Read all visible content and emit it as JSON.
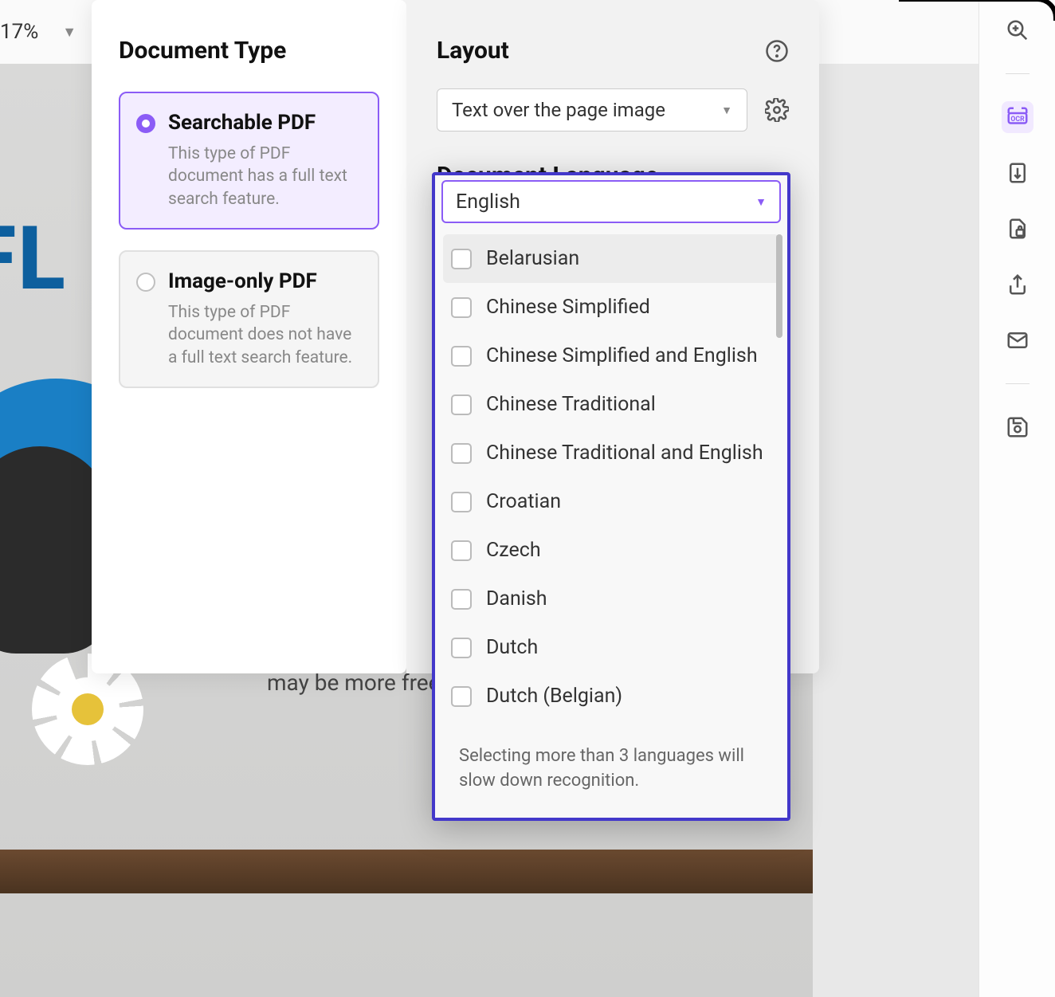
{
  "toolbar": {
    "zoom": "17%"
  },
  "left_panel": {
    "title": "Document Type",
    "options": [
      {
        "title": "Searchable PDF",
        "desc": "This type of PDF document has a full text search feature."
      },
      {
        "title": "Image-only PDF",
        "desc": "This type of PDF document does not have a full text search feature."
      }
    ]
  },
  "right_panel": {
    "layout_title": "Layout",
    "layout_value": "Text over the page image",
    "lang_title": "Document Language"
  },
  "lang_dropdown": {
    "selected": "English",
    "options": [
      "Belarusian",
      "Chinese Simplified",
      "Chinese Simplified and English",
      "Chinese Traditional",
      "Chinese Traditional and English",
      "Croatian",
      "Czech",
      "Danish",
      "Dutch",
      "Dutch (Belgian)"
    ],
    "note": "Selecting more than 3 languages will slow down recognition."
  },
  "background": {
    "big_text": "FL",
    "paragraph": "may be more free-form"
  }
}
